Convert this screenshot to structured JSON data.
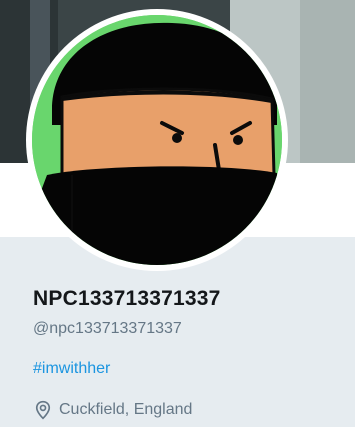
{
  "profile": {
    "display_name": "NPC133713371337",
    "handle": "@npc133713371337",
    "bio_hashtag": "#imwithher",
    "location": "Cuckfield, England"
  },
  "icons": {
    "location": "map-pin-icon"
  },
  "colors": {
    "page_bg": "#e6ecf0",
    "name": "#14171a",
    "secondary_text": "#657786",
    "link": "#1b95e0",
    "avatar_bg": "#69d66d"
  }
}
